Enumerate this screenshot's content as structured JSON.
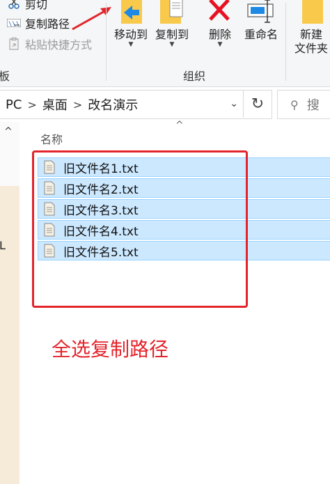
{
  "ribbon": {
    "clipboard": {
      "cut_label": "剪切",
      "copy_path_label": "复制路径",
      "paste_shortcut_label": "粘贴快捷方式",
      "group_label_fragment": "板"
    },
    "organize": {
      "move_to_label": "移动到",
      "copy_to_label": "复制到",
      "delete_label": "删除",
      "rename_label": "重命名",
      "group_label": "组织"
    },
    "new": {
      "new_folder_label_1": "新建",
      "new_folder_label_2": "文件夹"
    }
  },
  "address": {
    "crumbs": [
      "PC",
      "桌面",
      "改名演示"
    ],
    "search_placeholder": "搜"
  },
  "nav": {
    "edge_text": "L"
  },
  "filelist": {
    "column_name": "名称",
    "files": [
      "旧文件名1.txt",
      "旧文件名2.txt",
      "旧文件名3.txt",
      "旧文件名4.txt",
      "旧文件名5.txt"
    ]
  },
  "annotation": {
    "caption": "全选复制路径"
  },
  "colors": {
    "selection_bg": "#cce8ff",
    "selection_border": "#99d1ff",
    "annotation_red": "#e3242b",
    "folder_yellow": "#f8c94a",
    "delete_red": "#e81123",
    "move_arrow_blue": "#1e88e5"
  }
}
